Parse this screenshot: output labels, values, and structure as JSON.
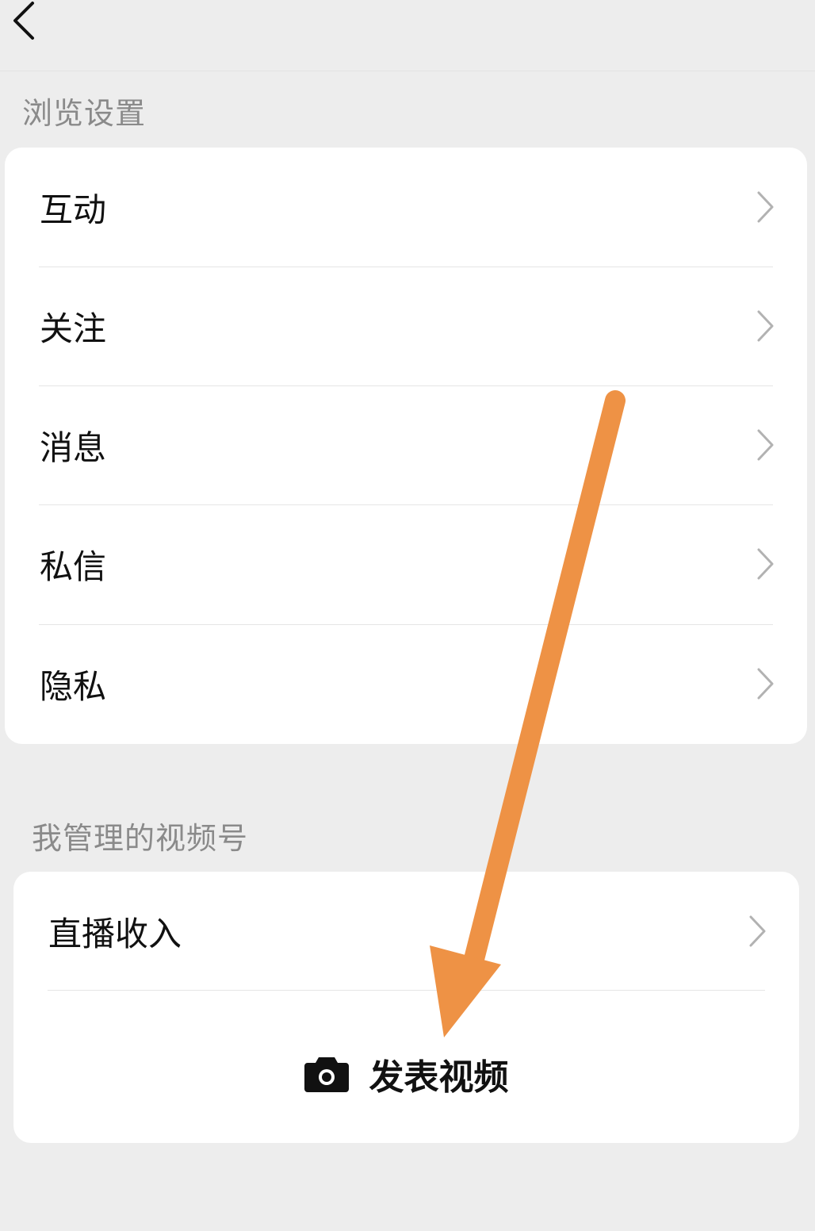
{
  "header": {
    "back_icon": "chevron-left-icon"
  },
  "browse_settings": {
    "title": "浏览设置",
    "items": [
      {
        "label": "互动",
        "icon": "chevron-right-icon"
      },
      {
        "label": "关注",
        "icon": "chevron-right-icon"
      },
      {
        "label": "消息",
        "icon": "chevron-right-icon"
      },
      {
        "label": "私信",
        "icon": "chevron-right-icon"
      },
      {
        "label": "隐私",
        "icon": "chevron-right-icon"
      }
    ]
  },
  "managed_channels": {
    "title": "我管理的视频号",
    "items": [
      {
        "label": "直播收入",
        "icon": "chevron-right-icon"
      }
    ],
    "publish": {
      "label": "发表视频",
      "icon": "camera-icon"
    }
  },
  "annotation": {
    "color": "#ee9245",
    "icon": "arrow-annotation"
  }
}
